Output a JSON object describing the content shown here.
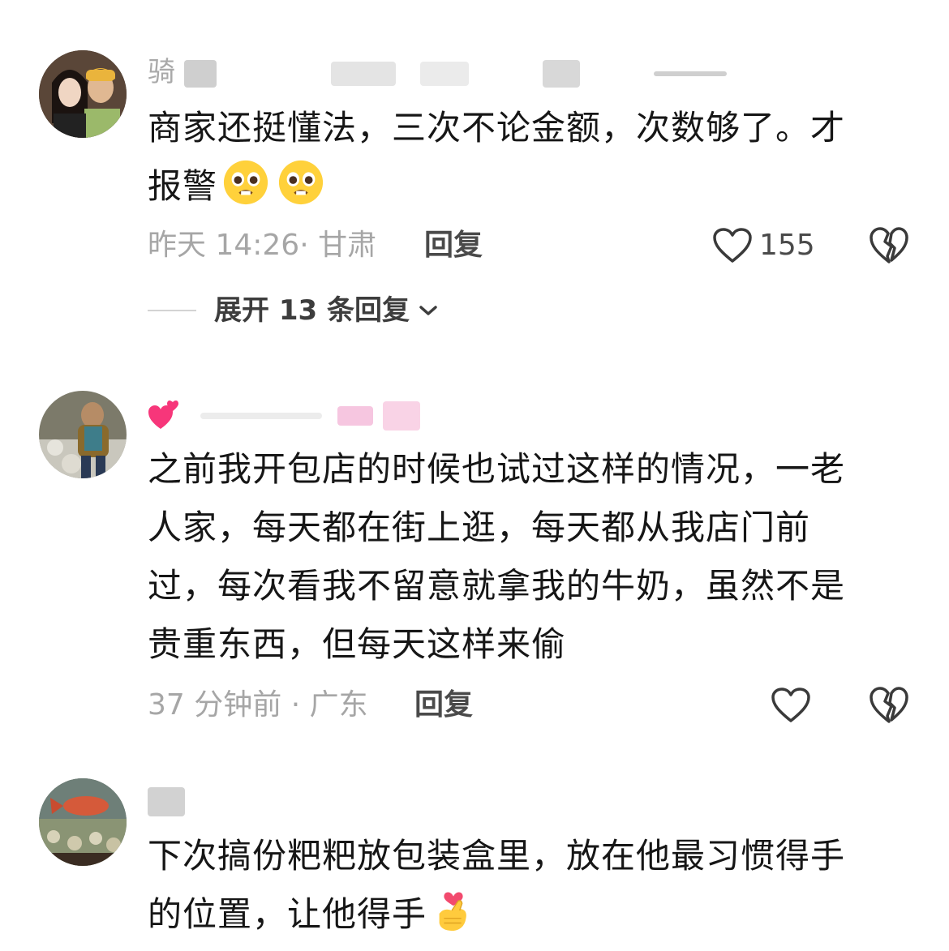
{
  "comments": [
    {
      "username": "骑",
      "content_lines": [
        "商家还挺懂法，三次不论金额，次数够了。才",
        "报警"
      ],
      "content_emojis": [
        "pleading-face",
        "pleading-face"
      ],
      "time_location": "昨天 14:26· 甘肃",
      "reply_label": "回复",
      "like_count": "155",
      "expand_label": "展开 13 条回复"
    },
    {
      "username": "",
      "username_emoji": "two-hearts",
      "content_lines": [
        "之前我开包店的时候也试过这样的情况，一老",
        "人家，每天都在街上逛，每天都从我店门前",
        "过，每次看我不留意就拿我的牛奶，虽然不是",
        "贵重东西，但每天这样来偷"
      ],
      "time_location": "37 分钟前 · 广东",
      "reply_label": "回复",
      "like_count": ""
    },
    {
      "username": "",
      "content_lines": [
        "下次搞份粑粑放包装盒里，放在他最习惯得手",
        "的位置，让他得手"
      ],
      "content_emojis": [
        "finger-heart"
      ],
      "time_location": ""
    }
  ],
  "icons": {
    "like": "heart-outline-icon",
    "dislike": "broken-heart-icon",
    "expand": "chevron-down-icon"
  },
  "colors": {
    "text": "#161616",
    "meta": "#a6a6a6",
    "reply": "#4a4a4a"
  }
}
